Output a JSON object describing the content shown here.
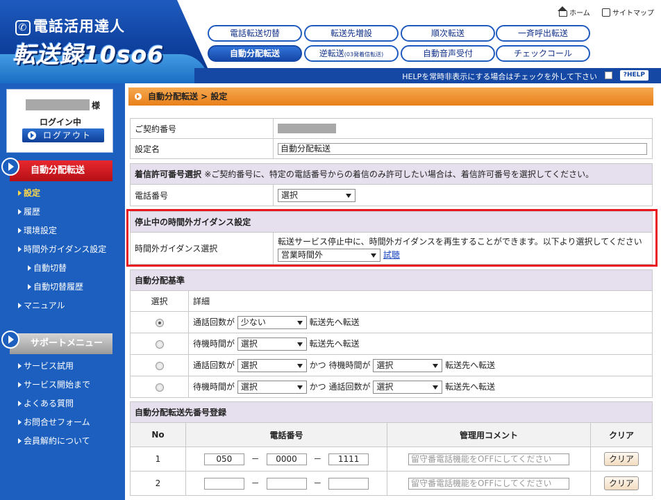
{
  "header": {
    "logo_line1": "電話活用達人",
    "logo_line2": "転送録10so6",
    "top_links": {
      "home": "ホーム",
      "sitemap": "サイトマップ"
    },
    "nav": [
      {
        "label": "電話転送切替",
        "active": false
      },
      {
        "label": "転送先増設",
        "active": false
      },
      {
        "label": "順次転送",
        "active": false
      },
      {
        "label": "一斉呼出転送",
        "active": false
      },
      {
        "label": "自動分配転送",
        "active": true
      },
      {
        "label": "逆転送",
        "small": "(03発着信転送)",
        "active": false
      },
      {
        "label": "自動音声受付",
        "active": false
      },
      {
        "label": "チェックコール",
        "active": false
      }
    ],
    "help_text": "HELPを常時非表示にする場合はチェックを外して下さい",
    "help_button": "?HELP"
  },
  "sidebar": {
    "login": {
      "suffix": "様",
      "status": "ログイン中",
      "logout": "ログアウト"
    },
    "section1": {
      "title": "自動分配転送",
      "items": [
        "設定",
        "履歴",
        "環境設定",
        "時間外ガイダンス設定",
        "自動切替",
        "自動切替履歴",
        "マニュアル"
      ]
    },
    "section2": {
      "title": "サポートメニュー",
      "items": [
        "サービス試用",
        "サービス開始まで",
        "よくある質問",
        "お問合せフォーム",
        "会員解約について"
      ]
    }
  },
  "main": {
    "breadcrumb": "自動分配転送 > 設定",
    "basic": {
      "contract_label": "ご契約番号",
      "setting_name_label": "設定名",
      "setting_name_value": "自動分配転送"
    },
    "allow": {
      "title": "着信許可番号選択",
      "note": "※ご契約番号に、特定の電話番号からの着信のみ許可したい場合は、着信許可番号を選択してください。",
      "phone_label": "電話番号",
      "phone_select": "選択"
    },
    "guidance": {
      "title": "停止中の時間外ガイダンス設定",
      "label": "時間外ガイダンス選択",
      "desc": "転送サービス停止中に、時間外ガイダンスを再生することができます。以下より選択してください",
      "select": "営業時間外",
      "try_link": "試聴"
    },
    "criteria": {
      "title": "自動分配基準",
      "col_select": "選択",
      "col_detail": "詳細",
      "rows": [
        {
          "checked": true,
          "a": "通話回数が",
          "sel1": "少ない",
          "mid": "",
          "sel2": "",
          "tail": "転送先へ転送"
        },
        {
          "checked": false,
          "a": "待機時間が",
          "sel1": "選択",
          "mid": "",
          "sel2": "",
          "tail": "転送先へ転送"
        },
        {
          "checked": false,
          "a": "通話回数が",
          "sel1": "選択",
          "mid": "かつ 待機時間が",
          "sel2": "選択",
          "tail": "転送先へ転送"
        },
        {
          "checked": false,
          "a": "待機時間が",
          "sel1": "選択",
          "mid": "かつ 通話回数が",
          "sel2": "選択",
          "tail": "転送先へ転送"
        }
      ]
    },
    "destinations": {
      "title": "自動分配転送先番号登録",
      "col_no": "No",
      "col_phone": "電話番号",
      "col_comment": "管理用コメント",
      "col_clear": "クリア",
      "dash": "－",
      "rows": [
        {
          "no": "1",
          "p1": "050",
          "p2": "0000",
          "p3": "1111",
          "comment_placeholder": "留守番電話機能をOFFにしてください",
          "clear": "クリア"
        },
        {
          "no": "2",
          "p1": "",
          "p2": "",
          "p3": "",
          "comment_placeholder": "留守番電話機能をOFFにしてください",
          "clear": "クリア"
        }
      ]
    }
  }
}
